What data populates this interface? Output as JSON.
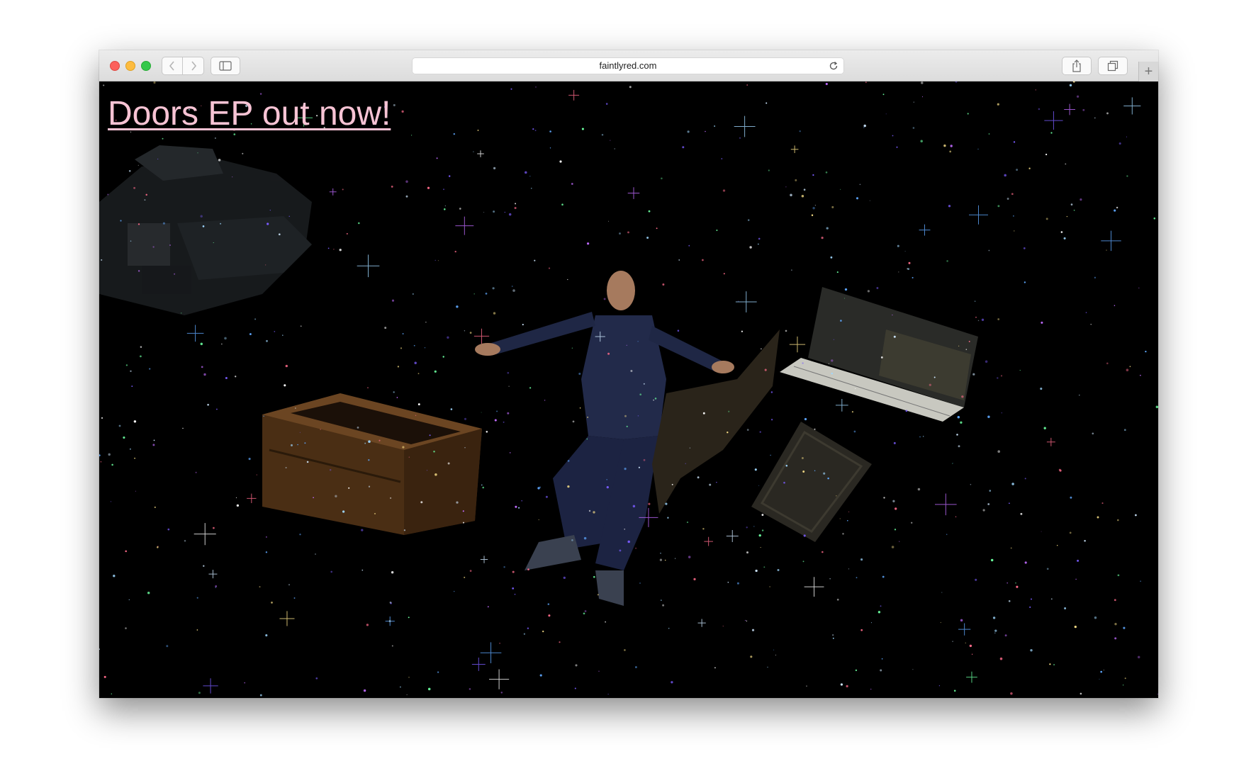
{
  "browser": {
    "url": "faintlyred.com",
    "newtab_label": "+"
  },
  "page": {
    "headline": "Doors EP out now!"
  },
  "colors": {
    "headline": "#f7c3d4",
    "background": "#000000"
  }
}
